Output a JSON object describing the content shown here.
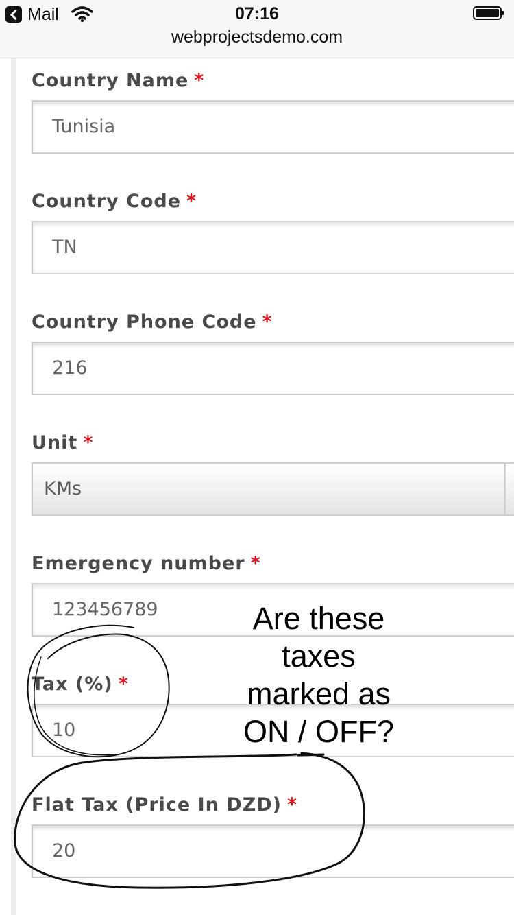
{
  "status_bar": {
    "back_label": "Mail",
    "time": "07:16",
    "url": "webprojectsdemo.com"
  },
  "form": {
    "required_marker": "*",
    "country_name": {
      "label": "Country Name",
      "value": "Tunisia"
    },
    "country_code": {
      "label": "Country Code",
      "value": "TN"
    },
    "phone_code": {
      "label": "Country Phone Code",
      "value": "216"
    },
    "unit": {
      "label": "Unit",
      "value": "KMs"
    },
    "emergency_number": {
      "label": "Emergency number",
      "value": "123456789"
    },
    "tax_percent": {
      "label": "Tax (%)",
      "value": "10"
    },
    "flat_tax": {
      "label": "Flat Tax (Price In DZD)",
      "value": "20"
    }
  },
  "annotation": {
    "line1": "Are these",
    "line2": "taxes",
    "line3": "marked as",
    "line4": "ON / OFF?",
    "ink_color": "#000000"
  },
  "colors": {
    "required": "#e0141e",
    "label": "#4a4a4a",
    "input_text": "#666666"
  }
}
